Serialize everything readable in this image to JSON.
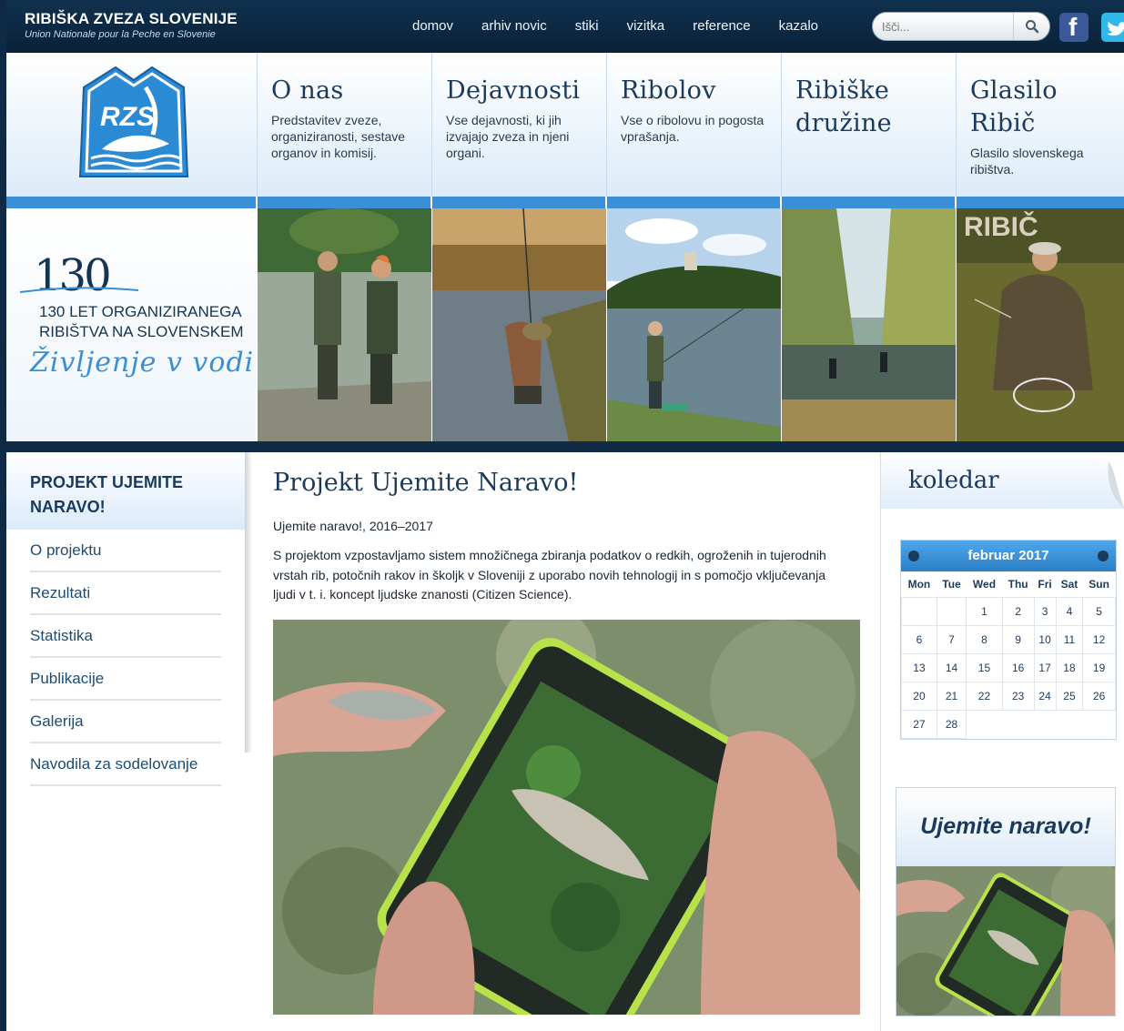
{
  "site": {
    "name": "RIBIŠKA ZVEZA SLOVENIJE",
    "subtitle": "Union Nationale pour la Peche en Slovenie",
    "logo_text": "RZS"
  },
  "topnav": [
    "domov",
    "arhiv novic",
    "stiki",
    "vizitka",
    "reference",
    "kazalo"
  ],
  "search": {
    "placeholder": "Išči..."
  },
  "social": {
    "facebook": "f"
  },
  "menu": [
    {
      "title": "O nas",
      "desc": "Predstavitev zveze, organiziranosti, sestave organov in komisij."
    },
    {
      "title": "Dejavnosti",
      "desc": "Vse dejavnosti, ki jih izvajajo zveza in njeni organi."
    },
    {
      "title": "Ribolov",
      "desc": "Vse o ribolovu in pogosta vprašanja."
    },
    {
      "title": "Ribiške družine",
      "desc": ""
    },
    {
      "title": "Glasilo Ribič",
      "desc": "Glasilo slovenskega ribištva."
    }
  ],
  "banner": {
    "number": "130",
    "line1": "130 LET ORGANIZIRANEGA",
    "line2": "RIBIŠTVA NA SLOVENSKEM",
    "tagline": "Življenje v vodi",
    "magazine_title": "RIBIČ"
  },
  "sidebar": {
    "heading": "PROJEKT UJEMITE NARAVO!",
    "items": [
      "O projektu",
      "Rezultati",
      "Statistika",
      "Publikacije",
      "Galerija",
      "Navodila za sodelovanje"
    ]
  },
  "article": {
    "title": "Projekt Ujemite Naravo!",
    "subtitle": "Ujemite naravo!, 2016–2017",
    "body": "S projektom vzpostavljamo sistem množičnega zbiranja podatkov o redkih, ogroženih in tujerodnih vrstah rib, potočnih rakov in školjk v Sloveniji z uporabo novih tehnologij in s pomočjo vključevanja ljudi v t. i. koncept ljudske znanosti (Citizen Science)."
  },
  "calendar": {
    "heading": "koledar",
    "month": "februar 2017",
    "weekdays": [
      "Mon",
      "Tue",
      "Wed",
      "Thu",
      "Fri",
      "Sat",
      "Sun"
    ],
    "weeks": [
      [
        "",
        "",
        "1",
        "2",
        "3",
        "4",
        "5"
      ],
      [
        "6",
        "7",
        "8",
        "9",
        "10",
        "11",
        "12"
      ],
      [
        "13",
        "14",
        "15",
        "16",
        "17",
        "18",
        "19"
      ],
      [
        "20",
        "21",
        "22",
        "23",
        "24",
        "25",
        "26"
      ],
      [
        "27",
        "28",
        "",
        "",
        "",
        "",
        ""
      ]
    ]
  },
  "ad": {
    "title": "Ujemite naravo!"
  },
  "colors": {
    "navy": "#0e2a45",
    "accent": "#3b8fd6",
    "heading": "#1a3a5c"
  }
}
